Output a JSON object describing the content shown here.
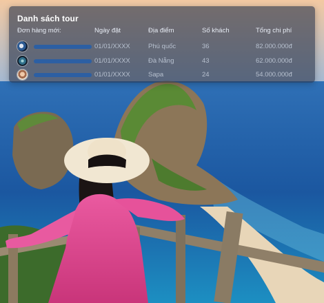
{
  "panel": {
    "title": "Danh sách tour",
    "headers": {
      "new_orders": "Đơn hàng mới:",
      "date": "Ngày đặt",
      "location": "Địa điểm",
      "guests": "Số khách",
      "total": "Tổng chi phí"
    },
    "rows": [
      {
        "avatar_icon": "avatar-icon",
        "date": "01/01/XXXX",
        "location": "Phú quốc",
        "guests": "36",
        "total": "82.000.000đ"
      },
      {
        "avatar_icon": "avatar-icon",
        "date": "01/01/XXXX",
        "location": "Đà Nẵng",
        "guests": "43",
        "total": "62.000.000đ"
      },
      {
        "avatar_icon": "avatar-icon",
        "date": "01/01/XXXX",
        "location": "Sapa",
        "guests": "24",
        "total": "54.000.000đ"
      }
    ]
  },
  "colors": {
    "panel_bg": "#28344a",
    "placeholder_bar": "#2c5fa3",
    "sea": "#1d5fa8",
    "dress": "#e0498f"
  }
}
